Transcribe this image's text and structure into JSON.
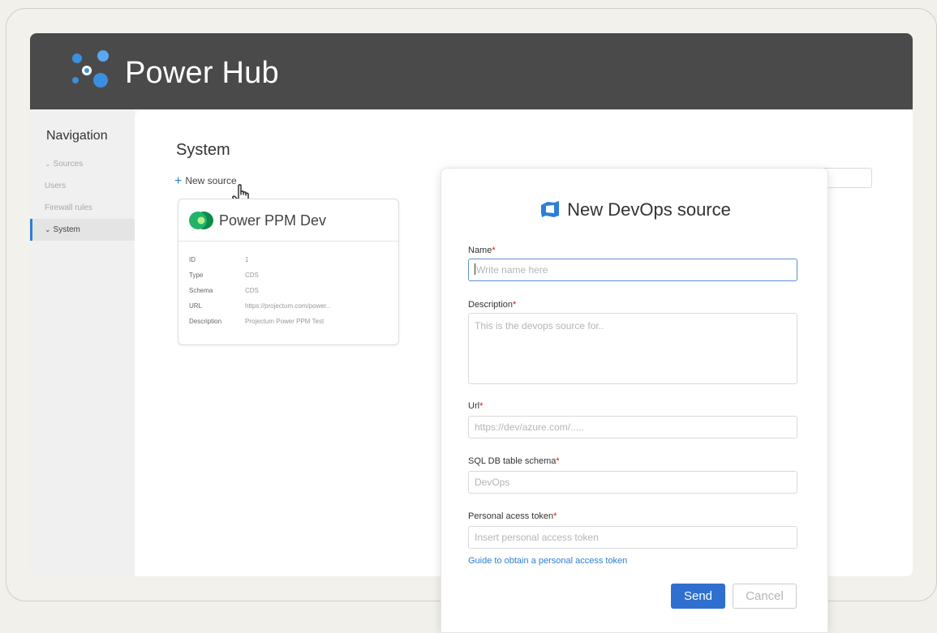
{
  "app": {
    "title": "Power Hub"
  },
  "sidebar": {
    "title": "Navigation",
    "items": [
      {
        "label": "Sources",
        "chevron": true,
        "active": false
      },
      {
        "label": "Users",
        "chevron": false,
        "active": false
      },
      {
        "label": "Firewall rules",
        "chevron": false,
        "active": false
      },
      {
        "label": "System",
        "chevron": true,
        "active": true
      }
    ]
  },
  "main": {
    "page_title": "System",
    "new_source_label": "New source",
    "card": {
      "title": "Power PPM Dev",
      "rows": [
        {
          "key": "ID",
          "value": "1"
        },
        {
          "key": "Type",
          "value": "CDS"
        },
        {
          "key": "Schema",
          "value": "CDS"
        },
        {
          "key": "URL",
          "value": "https://projectum.com/power.."
        },
        {
          "key": "Description",
          "value": "Projectum Power PPM Test"
        }
      ]
    }
  },
  "modal": {
    "title": "New DevOps source",
    "fields": {
      "name": {
        "label": "Name",
        "placeholder": "Write name here"
      },
      "description": {
        "label": "Description",
        "placeholder": "This is the devops source for.."
      },
      "url": {
        "label": "Url",
        "placeholder": "https://dev/azure.com/....."
      },
      "schema": {
        "label": "SQL DB table schema",
        "placeholder": "DevOps"
      },
      "token": {
        "label": "Personal acess token",
        "placeholder": "Insert personal access token"
      }
    },
    "required_mark": "*",
    "guide_link": "Guide to obtain a personal access token",
    "send_label": "Send",
    "cancel_label": "Cancel"
  },
  "colors": {
    "accent": "#2f6fcf",
    "header_bg": "#4a4a4a",
    "required": "#dd1111",
    "link": "#2d7fd3"
  },
  "icons": {
    "logo": "power-hub-dots-logo",
    "cursor": "hand-pointer-icon",
    "card": "dataverse-icon",
    "modal": "azure-devops-icon"
  }
}
